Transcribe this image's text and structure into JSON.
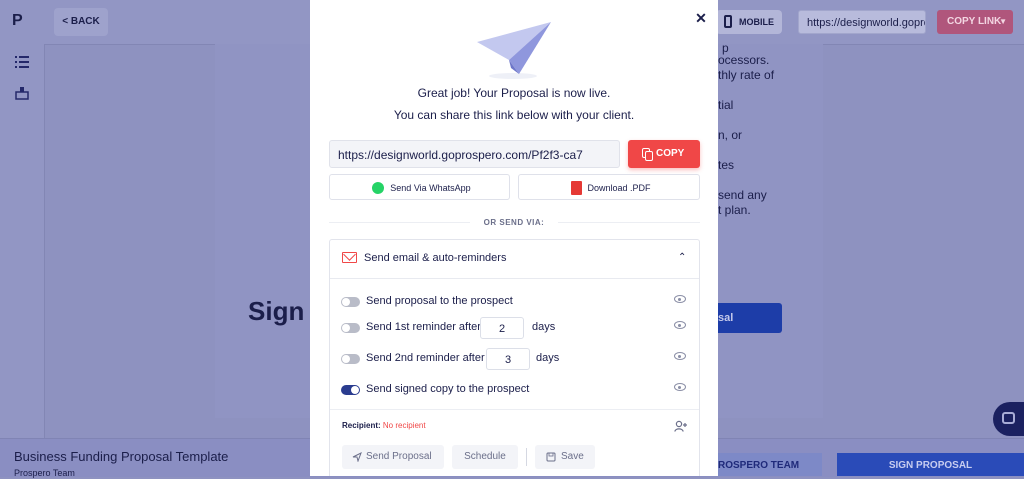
{
  "app": {
    "logo": "P",
    "back_label": "< BACK",
    "mobile_label": "MOBILE",
    "url_value": "https://designworld.gopro",
    "copy_link_label": "COPY LINK"
  },
  "document": {
    "right_lines": [
      "ocessors.",
      "thly rate of",
      "tial",
      "n, or",
      "tes",
      "send any",
      "t plan."
    ],
    "right_partial_top": "p",
    "heading_partial": "Sign",
    "button_partial": "sal"
  },
  "footer": {
    "title": "Business Funding  Proposal Template",
    "subtitle": "Prospero Team",
    "team_button": "ROSPERO TEAM",
    "sign_button": "SIGN PROPOSAL"
  },
  "modal": {
    "message_line1": "Great job! Your Proposal is now live.",
    "message_line2": "You can share this link below with your client.",
    "link_value": "https://designworld.goprospero.com/Pf2f3-ca7",
    "copy_label": "COPY",
    "whatsapp_label": "Send Via WhatsApp",
    "pdf_label": "Download .PDF",
    "or_send_via": "OR SEND VIA:",
    "panel_title": "Send email & auto-reminders",
    "rows": [
      {
        "label": "Send proposal to the prospect",
        "on": false
      },
      {
        "label": "Send 1st reminder after",
        "value": "2",
        "unit": "days",
        "on": false
      },
      {
        "label": "Send 2nd reminder after",
        "value": "3",
        "unit": "days",
        "on": false
      },
      {
        "label": "Send signed copy to the prospect",
        "on": true
      }
    ],
    "recipient_label": "Recipient:",
    "recipient_value": "No recipient",
    "send_proposal_label": "Send Proposal",
    "schedule_label": "Schedule",
    "save_label": "Save"
  },
  "colors": {
    "accent": "#f04747",
    "overlay": "#8e92c0",
    "primary": "#2a4bb8"
  }
}
